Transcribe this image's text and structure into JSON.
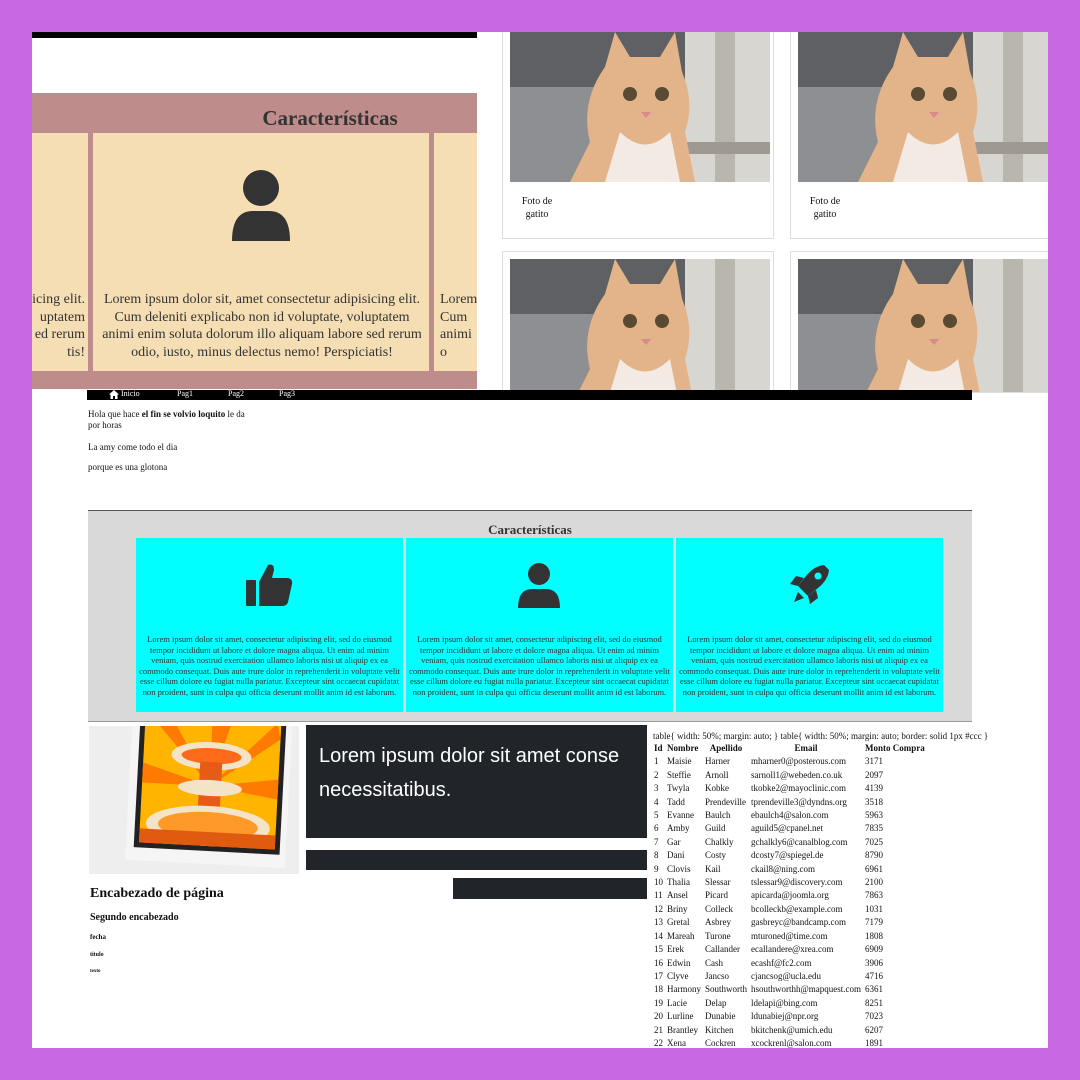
{
  "colors": {
    "frame": "#c869e3",
    "band": "#bf8c8c",
    "wheat": "#f5deb3",
    "cyan": "#00ffff",
    "dark": "#212529"
  },
  "panel_top": {
    "title": "Características",
    "left_card_text": "...icing elit. ...ptatem ...ed rerum ...tis!",
    "left_card_lines": [
      "icing elit.",
      "uptatem",
      "ed rerum",
      "tis!"
    ],
    "center_card_text": "Lorem ipsum dolor sit, amet consectetur adipisicing elit. Cum deleniti explicabo non id voluptate, voluptatem animi enim soluta dolorum illo aliquam labore sed rerum odio, iusto, minus delectus nemo! Perspiciatis!",
    "center_icon": "user-icon",
    "right_card_lines": [
      "Lorem",
      "Cum",
      "animi",
      "o"
    ]
  },
  "cats": {
    "caption": "Foto de gatito",
    "caption_line1": "Foto de",
    "caption_line2": "gatito"
  },
  "nav": {
    "items": [
      "Inicio",
      "Pag1",
      "Pag2",
      "Pag3"
    ],
    "home_icon": "home-icon"
  },
  "text": {
    "line1_a": "Hola que hace ",
    "line1_b": "el fin se volvio loquito",
    "line1_c": " le da",
    "line2": "por horas",
    "line3": "La amy come todo el dia",
    "line4": "porque es una glotona"
  },
  "features": {
    "title": "Características",
    "lorem": "Lorem ipsum dolor sit amet, consectetur adipiscing elit, sed do eiusmod tempor incididunt ut labore et dolore magna aliqua. Ut enim ad minim veniam, quis nostrud exercitation ullamco laboris nisi ut aliquip ex ea commodo consequat. Duis aute irure dolor in reprehenderit in voluptate velit esse cillum dolore eu fugiat nulla pariatur. Excepteur sint occaecat cupidatat non proident, sunt in culpa qui officia deserunt mollit anim id est laborum.",
    "icons": [
      "thumbs-up-icon",
      "user-icon",
      "rocket-icon"
    ]
  },
  "headings": {
    "h1": "Encabezado de página",
    "h2": "Segundo encabezado",
    "h3": "fecha",
    "h4": "titulo",
    "h5": "texto"
  },
  "dark_banner": {
    "line1": "Lorem ipsum dolor sit amet conse",
    "line2": "necessitatibus."
  },
  "table": {
    "css_caption": "table{ width: 50%; margin: auto; } table{ width: 50%; margin: auto; border: solid 1px #ccc }",
    "headers": [
      "Id",
      "Nombre",
      "Apellido",
      "Email",
      "Monto Compra"
    ],
    "rows": [
      [
        "1",
        "Maisie",
        "Harner",
        "mharner0@posterous.com",
        "3171"
      ],
      [
        "2",
        "Steffie",
        "Arnoll",
        "sarnoll1@webeden.co.uk",
        "2097"
      ],
      [
        "3",
        "Twyla",
        "Kobke",
        "tkobke2@mayoclinic.com",
        "4139"
      ],
      [
        "4",
        "Tadd",
        "Prendeville",
        "tprendeville3@dyndns.org",
        "3518"
      ],
      [
        "5",
        "Evanne",
        "Baulch",
        "ebaulch4@salon.com",
        "5963"
      ],
      [
        "6",
        "Amby",
        "Guild",
        "aguild5@cpanel.net",
        "7835"
      ],
      [
        "7",
        "Gar",
        "Chalkly",
        "gchalkly6@canalblog.com",
        "7025"
      ],
      [
        "8",
        "Dani",
        "Costy",
        "dcosty7@spiegel.de",
        "8790"
      ],
      [
        "9",
        "Clovis",
        "Kail",
        "ckail8@ning.com",
        "6961"
      ],
      [
        "10",
        "Thalia",
        "Slessar",
        "tslessar9@discovery.com",
        "2100"
      ],
      [
        "11",
        "Ansel",
        "Picard",
        "apicarda@joomla.org",
        "7863"
      ],
      [
        "12",
        "Briny",
        "Colleck",
        "bcolleckb@example.com",
        "1031"
      ],
      [
        "13",
        "Gretal",
        "Asbrey",
        "gasbreyc@bandcamp.com",
        "7179"
      ],
      [
        "14",
        "Mareah",
        "Turone",
        "mturoned@time.com",
        "1808"
      ],
      [
        "15",
        "Erek",
        "Callander",
        "ecallandere@xrea.com",
        "6909"
      ],
      [
        "16",
        "Edwin",
        "Cash",
        "ecashf@fc2.com",
        "3906"
      ],
      [
        "17",
        "Clyve",
        "Jancso",
        "cjancsog@ucla.edu",
        "4716"
      ],
      [
        "18",
        "Harmony",
        "Southworth",
        "hsouthworthh@mapquest.com",
        "6361"
      ],
      [
        "19",
        "Lacie",
        "Delap",
        "ldelapi@bing.com",
        "8251"
      ],
      [
        "20",
        "Lurline",
        "Dunabie",
        "ldunabiej@npr.org",
        "7023"
      ],
      [
        "21",
        "Brantley",
        "Kitchen",
        "bkitchenk@umich.edu",
        "6207"
      ],
      [
        "22",
        "Xena",
        "Cockren",
        "xcockrenl@salon.com",
        "1891"
      ]
    ]
  }
}
